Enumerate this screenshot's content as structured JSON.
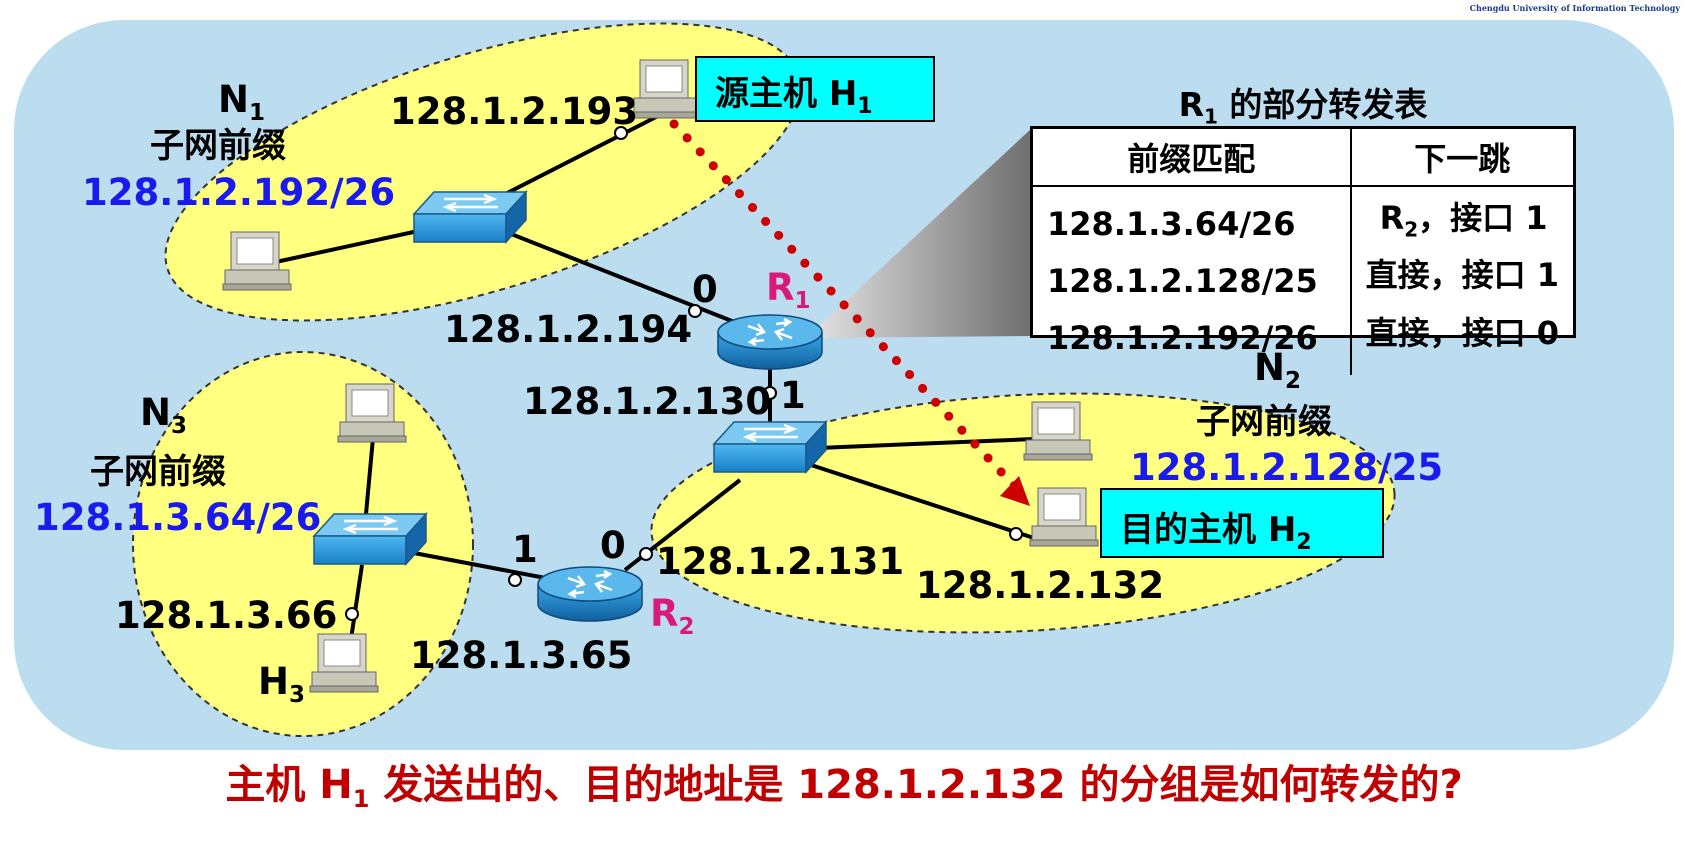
{
  "watermark": "Chengdu University of Information Technology",
  "networks": {
    "n1": {
      "name": "N",
      "sub": "1",
      "prefix_label": "子网前缀",
      "prefix": "128.1.2.192/26"
    },
    "n2": {
      "name": "N",
      "sub": "2",
      "prefix_label": "子网前缀",
      "prefix": "128.1.2.128/25"
    },
    "n3": {
      "name": "N",
      "sub": "3",
      "prefix_label": "子网前缀",
      "prefix": "128.1.3.64/26"
    }
  },
  "routers": {
    "r1": {
      "name": "R",
      "sub": "1"
    },
    "r2": {
      "name": "R",
      "sub": "2"
    }
  },
  "hosts": {
    "h1": {
      "label": "源主机 H",
      "sub": "1"
    },
    "h2": {
      "label": "目的主机 H",
      "sub": "2"
    },
    "h3": {
      "name": "H",
      "sub": "3"
    }
  },
  "addresses": {
    "h1_ip": "128.1.2.193",
    "r1_if0": "128.1.2.194",
    "r1_if1": "128.1.2.130",
    "r2_if0": "128.1.2.131",
    "h2_ip": "128.1.2.132",
    "r2_if1": "128.1.3.65",
    "h3_ip": "128.1.3.66"
  },
  "interfaces": {
    "r1_0": "0",
    "r1_1": "1",
    "r2_0": "0",
    "r2_1": "1"
  },
  "forwarding_table": {
    "title_prefix": "R",
    "title_sub": "1",
    "title_suffix": " 的部分转发表",
    "headers": [
      "前缀匹配",
      "下一跳"
    ],
    "rows": [
      {
        "prefix": "128.1.3.64/26",
        "next_hop_pre": "R",
        "next_hop_sub": "2",
        "next_hop_post": "，接口 1"
      },
      {
        "prefix": "128.1.2.128/25",
        "next_hop_pre": "直接，接口 1",
        "next_hop_sub": "",
        "next_hop_post": ""
      },
      {
        "prefix": "128.1.2.192/26",
        "next_hop_pre": "直接，接口 0",
        "next_hop_sub": "",
        "next_hop_post": ""
      }
    ]
  },
  "question": {
    "pre": "主机 H",
    "sub": "1",
    "post": " 发送出的、目的地址是 128.1.2.132 的分组是如何转发的?"
  },
  "colors": {
    "background": "#bcdcf0",
    "subnet_fill": "#ffff80",
    "host_box": "#00ffff",
    "prefix_text": "#1a1aee",
    "router_label": "#d81b7a",
    "arrow": "#cc0000",
    "question": "#c00000"
  }
}
